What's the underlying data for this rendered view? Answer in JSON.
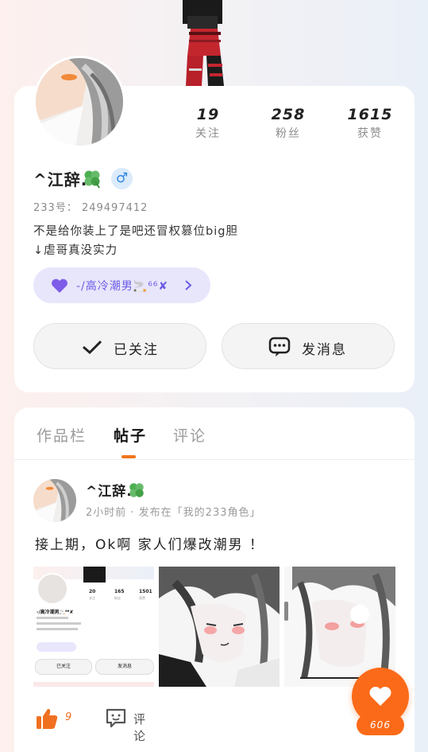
{
  "profile": {
    "username": "^江辞.",
    "gender_symbol": "♂",
    "uid_label": "233号：",
    "uid_value": "249497412",
    "bio_line1": "不是给你装上了是吧还冒权篡位big胆",
    "bio_line2": "↓虐哥真没实力",
    "role_pill": "-/高冷潮男🚬⁶⁶✘",
    "stats": [
      {
        "num": "19",
        "label": "关注"
      },
      {
        "num": "258",
        "label": "粉丝"
      },
      {
        "num": "1615",
        "label": "获赞"
      }
    ],
    "follow_button": "已关注",
    "message_button": "发消息"
  },
  "tabs": [
    {
      "label": "作品栏",
      "active": false
    },
    {
      "label": "帖子",
      "active": true
    },
    {
      "label": "评论",
      "active": false
    }
  ],
  "post": {
    "username": "^江辞.",
    "meta": "2小时前 · 发布在「我的233角色」",
    "text": "接上期，Ok啊 家人们爆改潮男 ！",
    "thumb1": {
      "stats": [
        "20",
        "165",
        "1501"
      ],
      "stat_labels": [
        "关注",
        "粉丝",
        "获赞"
      ],
      "username": "-/高冷潮男🚬⁶⁶✘",
      "follow": "已关注",
      "message": "发消息"
    },
    "like_count": "9",
    "comment_label": "评论"
  },
  "fab": {
    "count": "606"
  },
  "colors": {
    "accent": "#fb6a18",
    "tab_indicator": "#f0741a",
    "pill_bg": "#e8e6fb",
    "pill_text": "#6c5ce7",
    "gender_bg": "#dcebfb",
    "gender_fg": "#2f86e3"
  }
}
